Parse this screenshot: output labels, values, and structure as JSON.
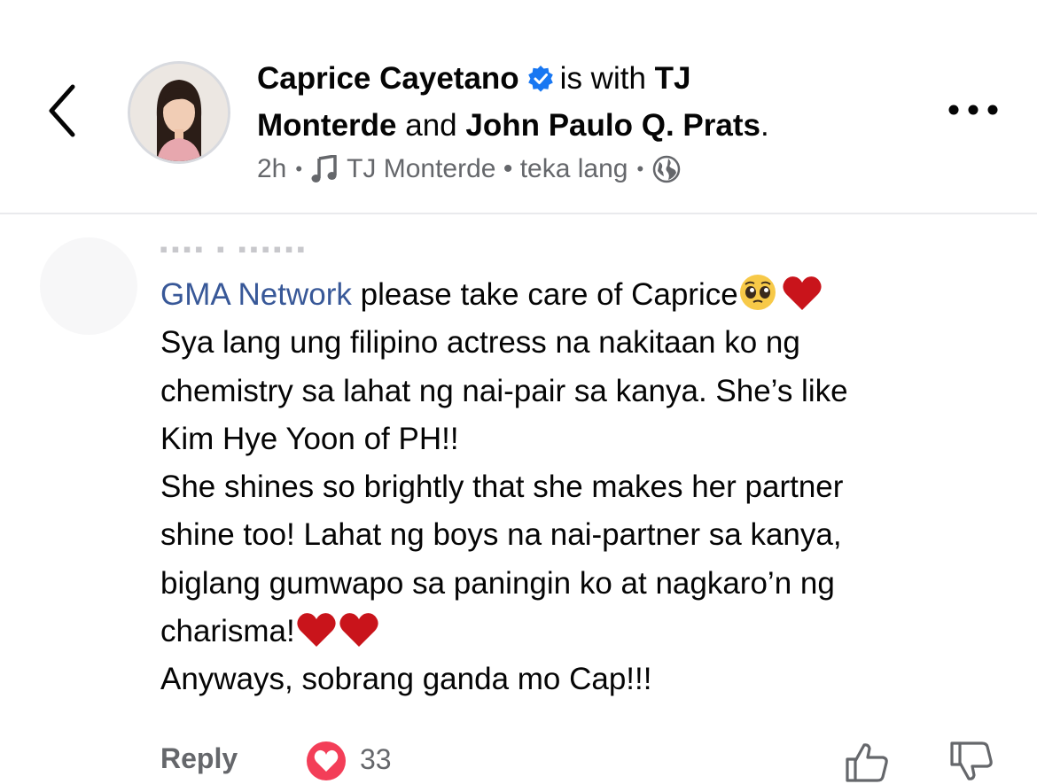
{
  "header": {
    "author": "Caprice Cayetano",
    "with_text": "is with",
    "tag1_line1": "TJ",
    "tag1_line2": "Monterde",
    "and_text": "and",
    "tag2": "John Paulo Q. Prats",
    "period": ".",
    "time": "2h",
    "sep": "•",
    "music_artist": "TJ Monterde",
    "music_sep": "•",
    "music_song": "teka lang",
    "sep2": "•",
    "privacy_icon": "globe-icon"
  },
  "comment": {
    "mention": "GMA Network",
    "line1_rest": " please take care of Caprice",
    "line2": "Sya lang ung filipino actress na nakitaan ko ng",
    "line3": "chemistry sa lahat ng nai-pair sa kanya. She’s like",
    "line4": "Kim Hye Yoon of PH!!",
    "line5": "She shines so brightly that she makes her partner",
    "line6": "shine too! Lahat ng boys na nai-partner sa kanya,",
    "line7": "biglang gumwapo sa paningin ko at nagkaro’n ng",
    "line8": "charisma!",
    "line9": "Anyways, sobrang ganda mo Cap!!!"
  },
  "actions": {
    "reply_label": "Reply",
    "reaction_count": "33",
    "reaction_color": "#f33e58"
  },
  "colors": {
    "mention": "#385898",
    "secondary": "#65676b",
    "verified": "#1877f2"
  }
}
